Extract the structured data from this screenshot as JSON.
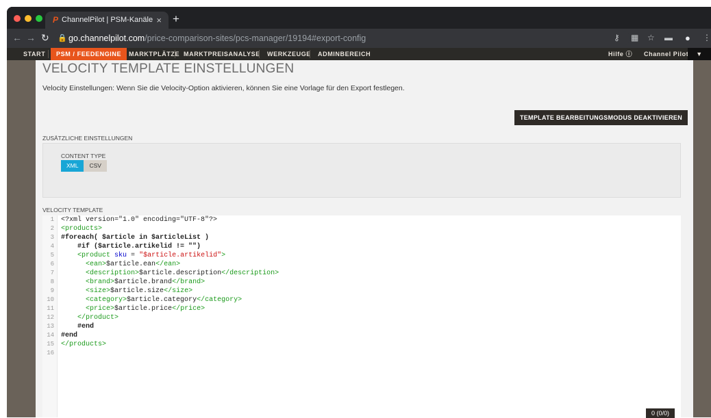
{
  "browser": {
    "tab_title": "ChannelPilot | PSM-Kanäle",
    "tab_favicon": "P",
    "tab_close": "×",
    "new_tab": "+",
    "url_domain": "go.channelpilot.com",
    "url_path": "/price-comparison-sites/pcs-manager/19194#export-config"
  },
  "nav": {
    "items": [
      "START",
      "PSM / FEEDENGINE",
      "MARKTPLÄTZE",
      "MARKTPREISANALYSE",
      "WERKZEUGE",
      "ADMINBEREICH"
    ],
    "help_label": "Hilfe",
    "account_label": "Channel Pilot"
  },
  "page": {
    "title": "VELOCITY TEMPLATE EINSTELLUNGEN",
    "description": "Velocity Einstellungen: Wenn Sie die Velocity-Option aktivieren, können Sie eine Vorlage für den Export festlegen.",
    "deactivate_button": "TEMPLATE BEARBEITUNGSMODUS DEAKTIVIEREN",
    "additional_settings_label": "ZUSÄTZLICHE EINSTELLUNGEN",
    "content_type_label": "CONTENT TYPE",
    "content_type_options": [
      "XML",
      "CSV"
    ],
    "content_type_selected": "XML",
    "velocity_template_label": "VELOCITY TEMPLATE"
  },
  "editor": {
    "line_numbers": [
      "1",
      "2",
      "3",
      "4",
      "5",
      "6",
      "7",
      "8",
      "9",
      "10",
      "11",
      "12",
      "13",
      "14",
      "15",
      "16"
    ],
    "lines": [
      "<?xml version=\"1.0\" encoding=\"UTF-8\"?>",
      "<products>",
      "#foreach( $article in $articleList )",
      "    #if ($article.artikelid != \"\")",
      "    <product sku = \"$article.artikelid\">",
      "      <ean>$article.ean</ean>",
      "      <description>$article.description</description>",
      "      <brand>$article.brand</brand>",
      "      <size>$article.size</size>",
      "      <category>$article.category</category>",
      "      <price>$article.price</price>",
      "    </product>",
      "    #end",
      "#end",
      "</products>",
      ""
    ]
  },
  "status": {
    "search_count": "0 (0/0)"
  },
  "colors": {
    "accent": "#e8551c",
    "toggle_on": "#18a6d6",
    "nav_bg": "#2b2a27"
  }
}
